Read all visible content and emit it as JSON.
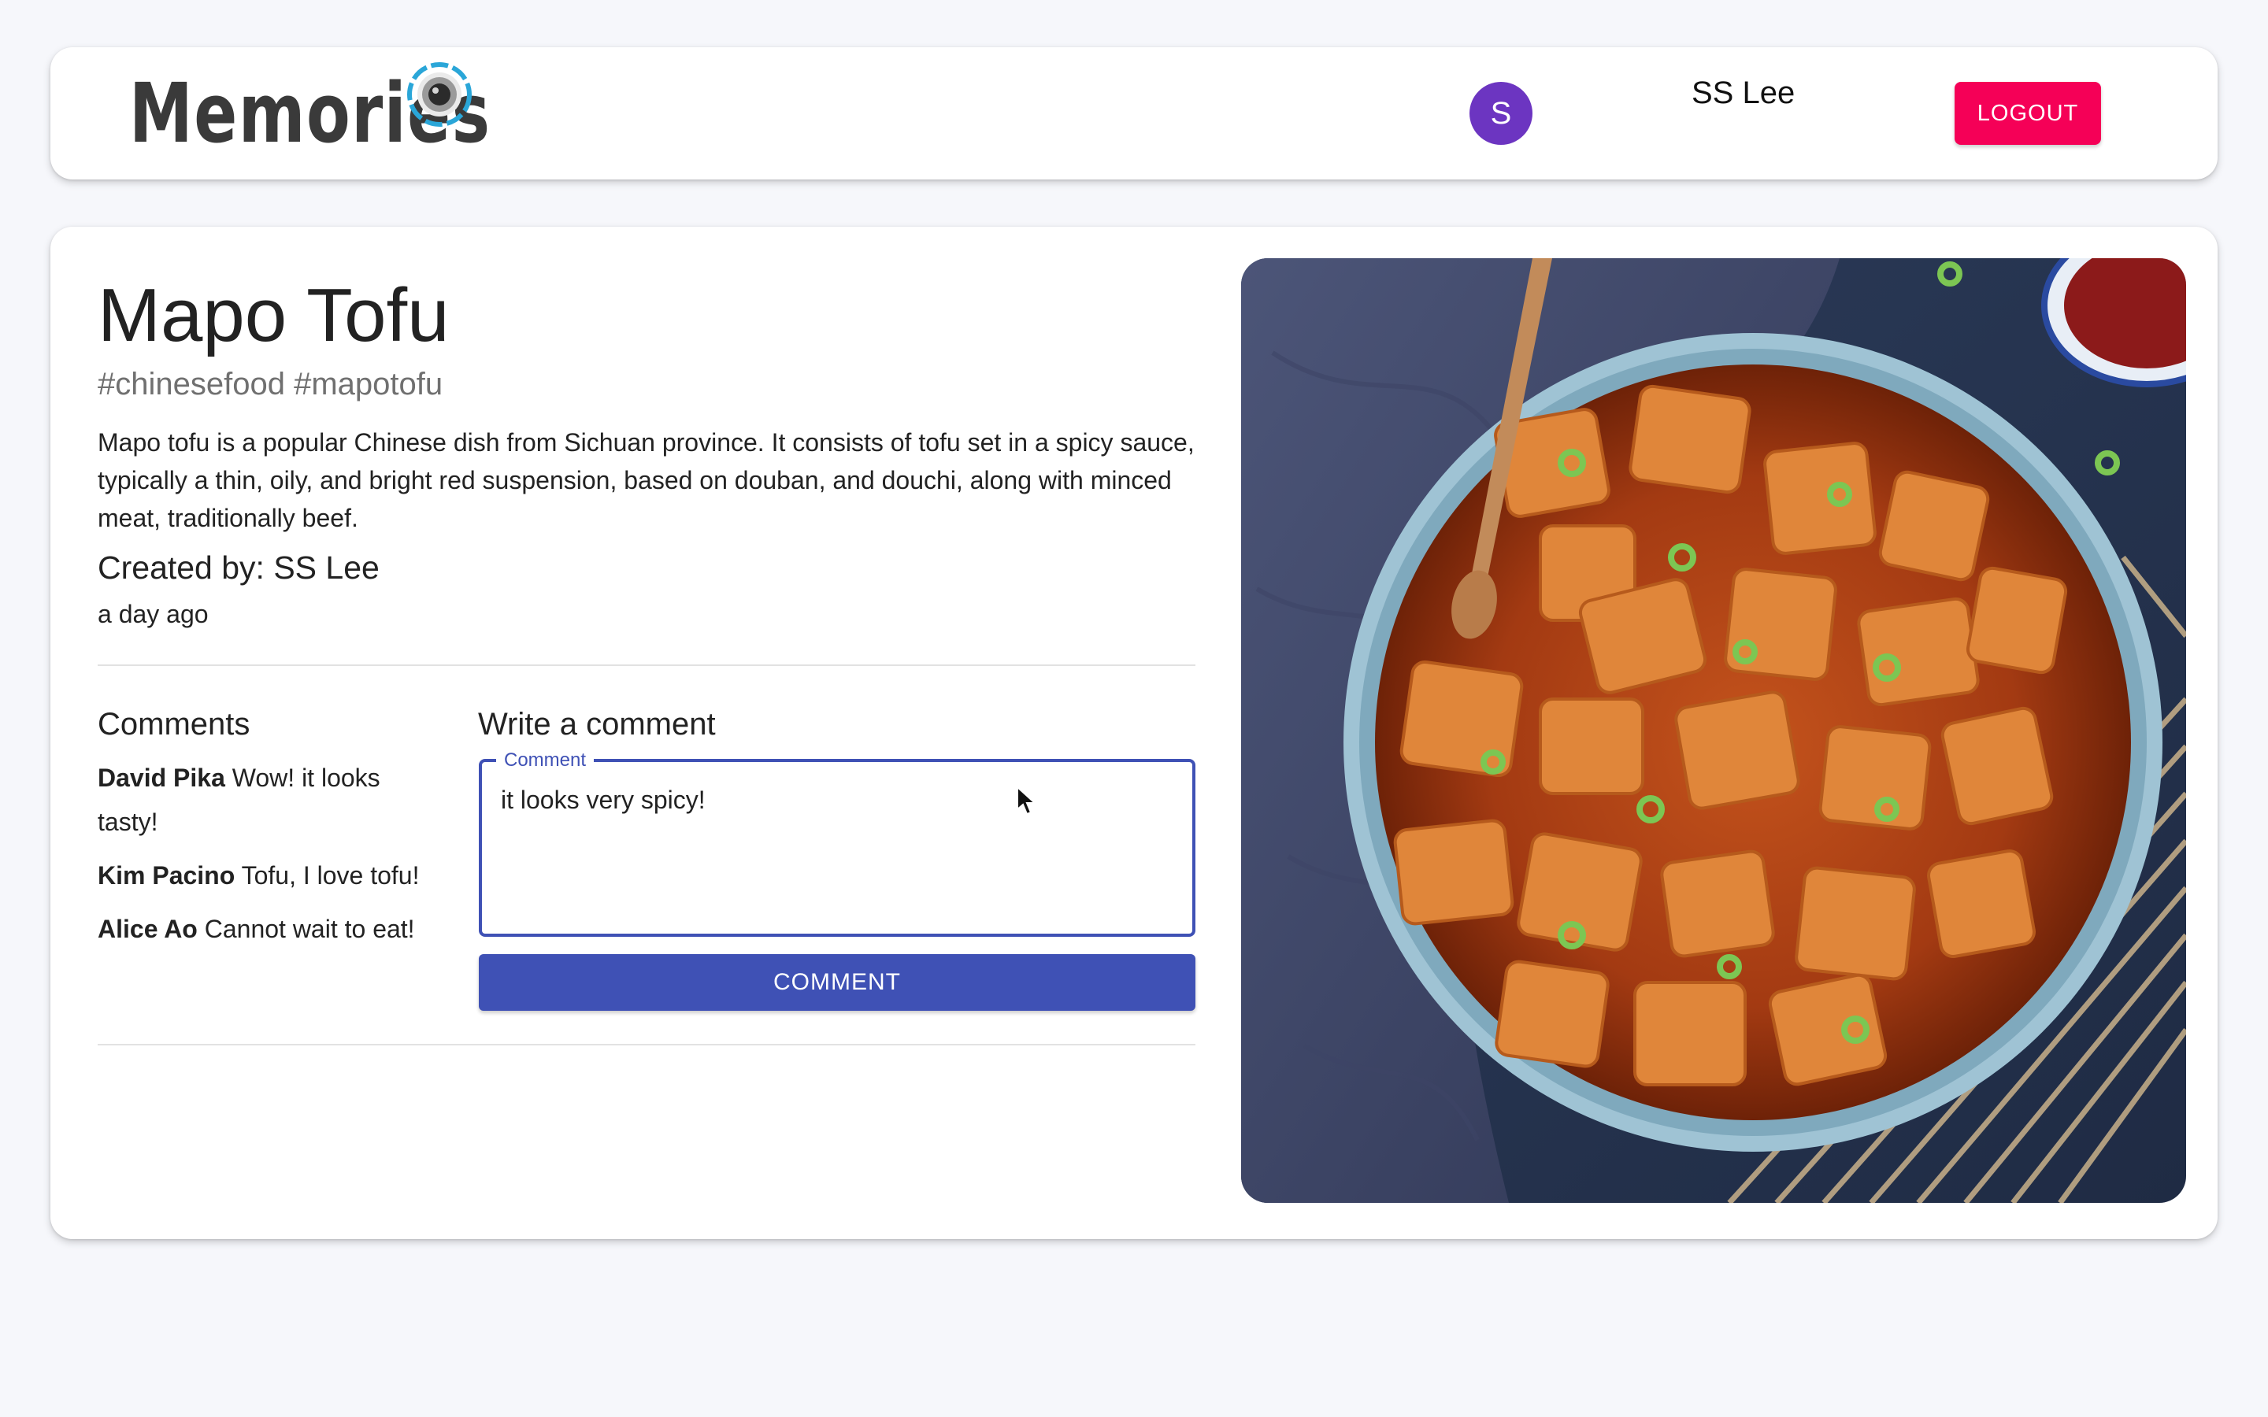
{
  "header": {
    "brand_title": "Memories",
    "brand_logo_icon": "camera-lens-icon",
    "user": {
      "avatar_initial": "S",
      "avatar_color": "#6c35c1",
      "name": "SS Lee"
    },
    "logout_label": "LOGOUT",
    "logout_color": "#f50057"
  },
  "post": {
    "title": "Mapo Tofu",
    "tags": "#chinesefood #mapotofu",
    "description": "Mapo tofu is a popular Chinese dish from Sichuan province. It consists of tofu set in a spicy sauce, typically a thin, oily, and bright red suspension, based on douban, and douchi, along with minced meat, traditionally beef.",
    "created_by": "Created by: SS Lee",
    "time_ago": "a day ago",
    "image_alt_icon": "mapo-tofu-photo"
  },
  "comments": {
    "heading": "Comments",
    "items": [
      {
        "author": "David Pika",
        "text": "Wow! it looks tasty!"
      },
      {
        "author": "Kim Pacino",
        "text": "Tofu, I love tofu!"
      },
      {
        "author": "Alice Ao",
        "text": "Cannot wait to eat!"
      }
    ]
  },
  "write_comment": {
    "heading": "Write a comment",
    "field_label": "Comment",
    "value": "it looks very spicy!",
    "submit_label": "COMMENT",
    "accent_color": "#3f51b5"
  }
}
